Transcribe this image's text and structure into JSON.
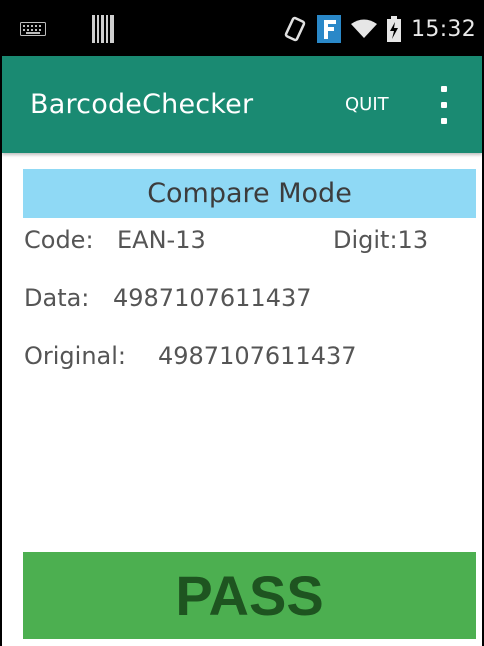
{
  "status_bar": {
    "time": "15:32",
    "icons": [
      "keyboard-icon",
      "barcode-icon",
      "screen-rotation-icon",
      "f-app-icon",
      "wifi-icon",
      "battery-charging-icon"
    ]
  },
  "app_bar": {
    "title": "BarcodeChecker",
    "quit_label": "QUIT",
    "menu_icon": "overflow-menu-icon"
  },
  "mode_banner": "Compare Mode",
  "scan_info": {
    "code_label": "Code:",
    "code_value": "EAN-13",
    "digit_label": "Digit:",
    "digit_value": "13",
    "data_label": "Data:",
    "data_value": "4987107611437",
    "original_label": "Original:",
    "original_value": "4987107611437"
  },
  "result": {
    "text": "PASS",
    "color": "#4caf50"
  },
  "colors": {
    "app_bar": "#1a8a72",
    "banner": "#8fd9f5"
  }
}
